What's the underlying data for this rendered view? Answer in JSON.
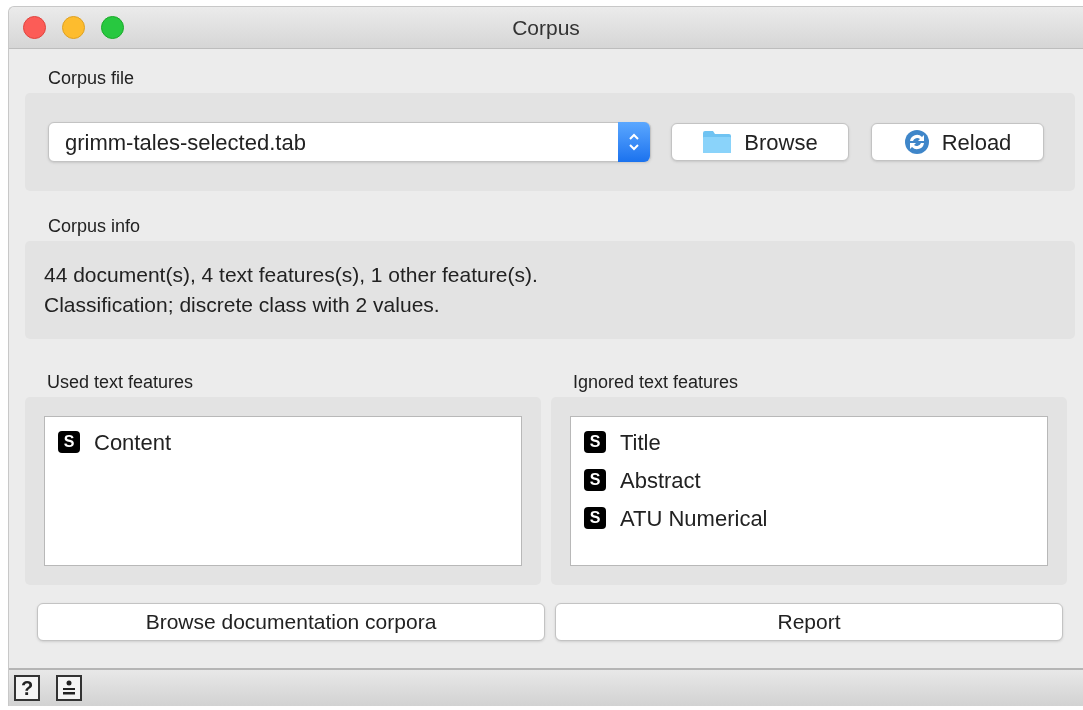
{
  "window": {
    "title": "Corpus"
  },
  "corpus_file": {
    "label": "Corpus file",
    "file": "grimm-tales-selected.tab",
    "buttons": [
      {
        "kind": "browse",
        "label": "Browse"
      },
      {
        "kind": "reload",
        "label": "Reload"
      }
    ]
  },
  "corpus_info": {
    "label": "Corpus info",
    "lines": [
      "44 document(s), 4 text features(s), 1 other feature(s).",
      "Classification; discrete class with 2 values."
    ]
  },
  "feature_lists": [
    {
      "label": "Used text features",
      "items": [
        {
          "badge": "S",
          "name": "Content"
        }
      ]
    },
    {
      "label": "Ignored text features",
      "items": [
        {
          "badge": "S",
          "name": "Title"
        },
        {
          "badge": "S",
          "name": "Abstract"
        },
        {
          "badge": "S",
          "name": "ATU Numerical"
        }
      ]
    }
  ],
  "bottom_buttons": [
    "Browse documentation corpora",
    "Report"
  ],
  "status_bar": {
    "help": "?"
  }
}
